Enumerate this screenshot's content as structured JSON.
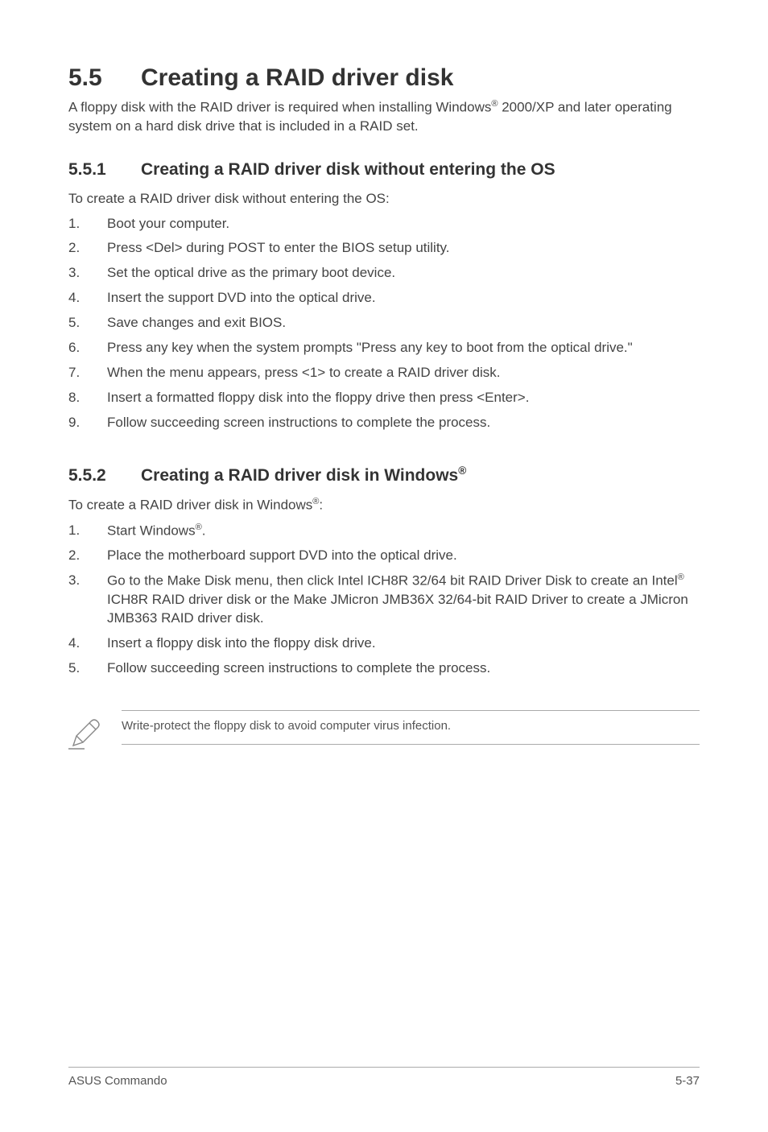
{
  "heading_main_num": "5.5",
  "heading_main_text": "Creating a RAID driver disk",
  "intro_text": "A floppy disk with the RAID driver is required when installing Windows® 2000/XP and later operating system on a hard disk drive that is included in a RAID set.",
  "section_a": {
    "num": "5.5.1",
    "title": "Creating a RAID driver disk without entering the OS",
    "lead": "To create a RAID driver disk without entering the OS:",
    "steps": [
      "Boot your computer.",
      "Press <Del> during POST to enter the BIOS setup utility.",
      "Set the optical drive as the primary boot device.",
      "Insert the support DVD into the optical drive.",
      "Save changes and exit BIOS.",
      "Press any key when the system prompts \"Press any key to boot from the optical drive.\"",
      "When the menu appears, press <1> to create a RAID driver disk.",
      "Insert a formatted floppy disk into the floppy drive then press <Enter>.",
      "Follow succeeding screen instructions to complete the process."
    ]
  },
  "section_b": {
    "num": "5.5.2",
    "title": "Creating a RAID driver disk in Windows®",
    "lead": "To create a RAID driver disk in Windows®:",
    "steps": [
      "Start Windows®.",
      "Place the motherboard support DVD into the optical drive.",
      "Go to the Make Disk menu, then click Intel ICH8R 32/64 bit RAID Driver Disk to create an Intel® ICH8R RAID driver disk or the Make JMicron JMB36X 32/64-bit RAID Driver to create a JMicron JMB363 RAID driver disk.",
      "Insert a floppy disk into the floppy disk drive.",
      "Follow succeeding screen instructions to complete the process."
    ]
  },
  "note_text": "Write-protect the floppy disk to avoid computer virus infection.",
  "footer_left": "ASUS Commando",
  "footer_right": "5-37"
}
